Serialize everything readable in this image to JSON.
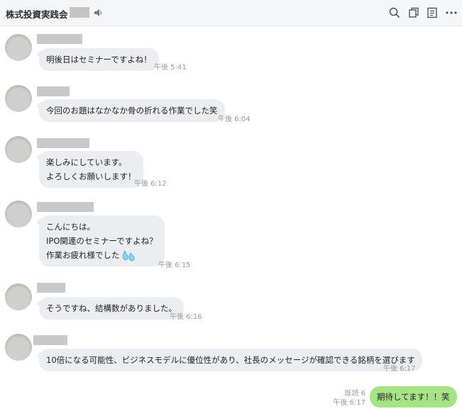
{
  "header": {
    "title": "株式投資実践会",
    "icons": [
      "speaker-icon",
      "search-icon",
      "copy-icon",
      "note-icon",
      "more-icon"
    ]
  },
  "messages": [
    {
      "lines": [
        "明後日はセミナーですよね！"
      ],
      "time": "午後 5:41"
    },
    {
      "lines": [
        "今回のお題はなかなか骨の折れる作業でした笑"
      ],
      "time": "午後 6:04"
    },
    {
      "lines": [
        "楽しみにしています。",
        "よろしくお願いします！"
      ],
      "time": "午後 6:12"
    },
    {
      "lines": [
        "こんにちは。",
        "IPO関連のセミナーですよね？",
        "作業お疲れ様でした"
      ],
      "time": "午後 6:15",
      "emoji": "sweat-drops-icon"
    },
    {
      "lines": [
        "そうですね、結構数がありました。"
      ],
      "time": "午後 6:16"
    },
    {
      "lines": [
        "10倍になる可能性、ビジネスモデルに優位性があり、社長のメッセージが確認できる銘柄を選びます"
      ],
      "time": "午後 6:17"
    }
  ],
  "my_message": {
    "text": "期待してます！！笑",
    "read": "既読 6",
    "time": "午後 6:17"
  },
  "colors": {
    "header_bg": "#f5f6f8",
    "bubble_other": "#ebedf0",
    "bubble_mine": "#a6e386"
  }
}
